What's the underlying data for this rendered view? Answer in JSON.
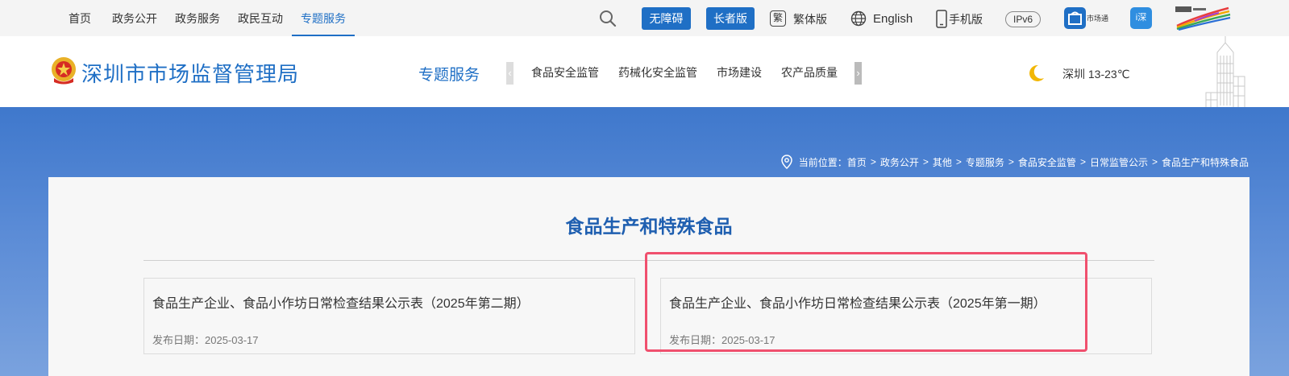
{
  "topnav": {
    "items": [
      "首页",
      "政务公开",
      "政务服务",
      "政民互动",
      "专题服务"
    ],
    "active_index": 4
  },
  "toolbar": {
    "accessible_label": "无障碍",
    "elder_label": "长者版",
    "traditional_glyph": "繁",
    "traditional_label": "繁体版",
    "english_label": "English",
    "mobile_label": "手机版",
    "ipv6_label": "IPv6",
    "market_app_label": "市场通",
    "app_glyph": "i深",
    "accent_color": "#1f6fc5"
  },
  "header": {
    "site_title": "深圳市市场监督管理局",
    "section_title": "专题服务",
    "subnav": [
      "食品安全监管",
      "药械化安全监管",
      "市场建设",
      "农产品质量安全"
    ],
    "arrow_left": "‹",
    "arrow_right": "›",
    "weather": "深圳 13-23℃"
  },
  "breadcrumb": {
    "prefix": "当前位置：",
    "items": [
      "首页",
      "政务公开",
      "其他",
      "专题服务",
      "食品安全监管",
      "日常监管公示",
      "食品生产和特殊食品"
    ],
    "separator": ">"
  },
  "main": {
    "title": "食品生产和特殊食品",
    "cards": [
      {
        "title": "食品生产企业、食品小作坊日常检查结果公示表（2025年第二期）",
        "date": "发布日期：2025-03-17"
      },
      {
        "title": "食品生产企业、食品小作坊日常检查结果公示表（2025年第一期）",
        "date": "发布日期：2025-03-17"
      }
    ],
    "highlight_color": "#f0506e"
  }
}
